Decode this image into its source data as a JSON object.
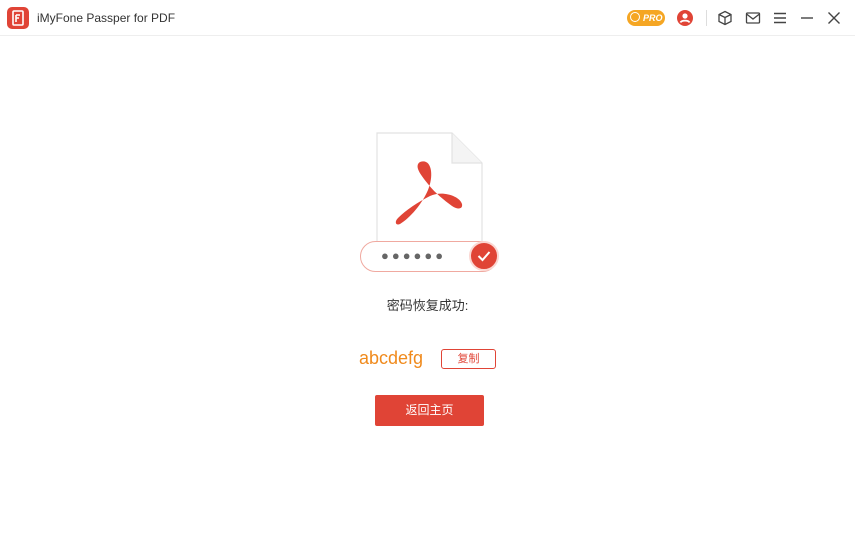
{
  "window": {
    "title": "iMyFone Passper for PDF",
    "pro_badge": "PRO"
  },
  "toolbar": {
    "icons": [
      "pro-badge-icon",
      "account-icon",
      "package-icon",
      "mail-icon",
      "menu-icon",
      "minimize-icon",
      "close-icon"
    ]
  },
  "main": {
    "password_mask": "●●●●●●",
    "success_label": "密码恢复成功:",
    "recovered_password": "abcdefg",
    "copy_label": "复制",
    "home_label": "返回主页"
  },
  "colors": {
    "accent": "#e04436",
    "password": "#f08a1c",
    "pro": "#f5a623"
  }
}
